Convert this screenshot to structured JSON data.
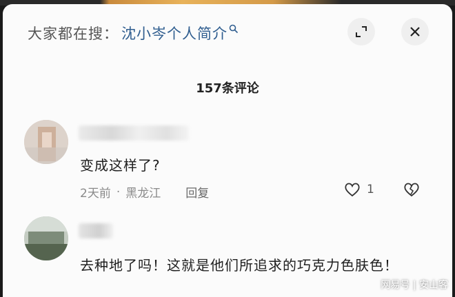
{
  "search": {
    "prefix": "大家都在搜：",
    "term": "沈小岑个人简介"
  },
  "header": {
    "comment_count": "157条评论"
  },
  "comments": [
    {
      "text": "变成这样了?",
      "time": "2天前",
      "location": "黑龙江",
      "reply_label": "回复",
      "like_count": "1"
    },
    {
      "text": "去种地了吗！这就是他们所追求的巧克力色肤色！"
    }
  ],
  "watermark": "网易号 | 安山客",
  "colors": {
    "search_term": "#2f5d8f",
    "background": "#fbfbfb",
    "meta_text": "#8a8a8a"
  },
  "icons": {
    "search": "search-icon",
    "expand": "expand-icon",
    "close": "close-icon",
    "like": "heart-icon",
    "dislike": "broken-heart-icon"
  }
}
